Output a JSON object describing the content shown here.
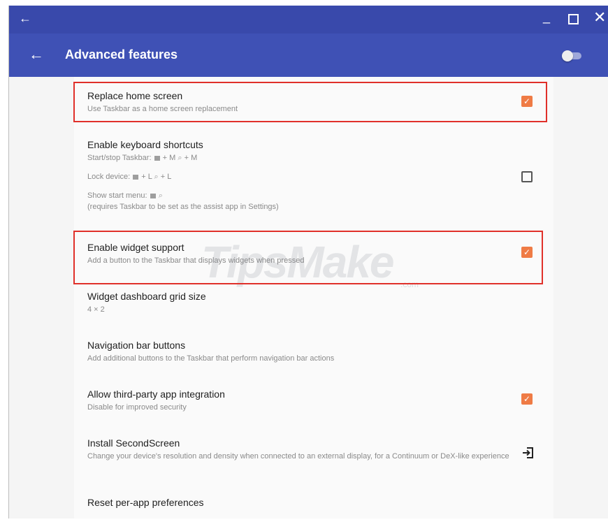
{
  "titlebar": {
    "back_glyph": "←",
    "min_glyph": "_",
    "close_glyph": "✕"
  },
  "appbar": {
    "back_glyph": "←",
    "title": "Advanced features"
  },
  "items": [
    {
      "title": "Replace home screen",
      "subtitle": "Use Taskbar as a home screen replacement",
      "checked": true
    },
    {
      "title": "Enable keyboard shortcuts",
      "line1_label": "Start/stop Taskbar:",
      "line1_keys": "+ M",
      "line1_keys2": "+ M",
      "line2_label": "Lock device:",
      "line2_keys": "+ L",
      "line2_keys2": "+ L",
      "line3_label": "Show start menu:",
      "line4": "(requires Taskbar to be set as the assist app in Settings)",
      "checked": false
    },
    {
      "title": "Enable widget support",
      "subtitle": "Add a button to the Taskbar that displays widgets when pressed",
      "checked": true
    },
    {
      "title": "Widget dashboard grid size",
      "subtitle": "4 × 2"
    },
    {
      "title": "Navigation bar buttons",
      "subtitle": "Add additional buttons to the Taskbar that perform navigation bar actions"
    },
    {
      "title": "Allow third-party app integration",
      "subtitle": "Disable for improved security",
      "checked": true
    },
    {
      "title": "Install SecondScreen",
      "subtitle": "Change your device's resolution and density when connected to an external display, for a Continuum or DeX-like experience"
    },
    {
      "title": "Reset per-app preferences"
    }
  ],
  "checkmark": "✓",
  "search_glyph": "⌕",
  "watermark": {
    "text": "TipsMake",
    "suffix": ".com"
  },
  "colors": {
    "titlebar": "#3949ab",
    "appbar": "#3f51b5",
    "accent": "#ef7b45",
    "highlight": "#e0302a"
  }
}
